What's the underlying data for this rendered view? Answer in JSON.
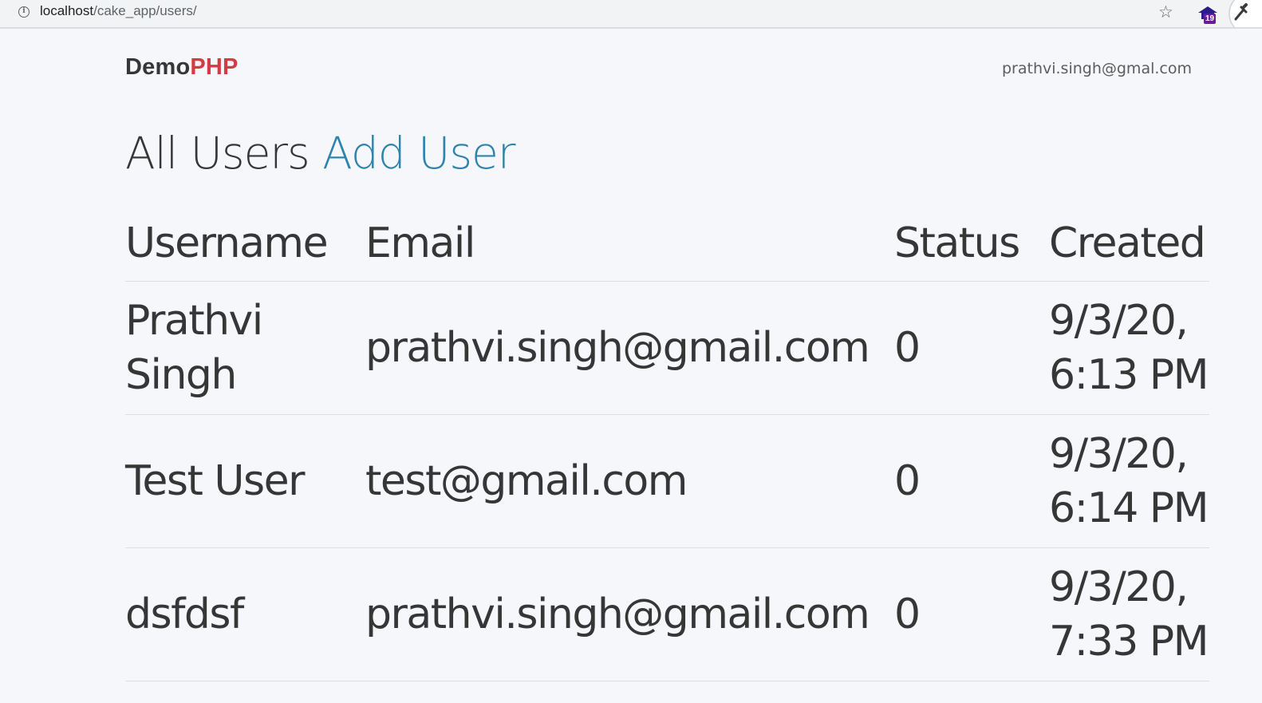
{
  "browser": {
    "url_host": "localhost",
    "url_path": "/cake_app/users/",
    "extension_badge": "19"
  },
  "header": {
    "brand_part1": "Demo",
    "brand_part2": "PHP",
    "user_email": "prathvi.singh@gmal.com"
  },
  "main": {
    "title": "All Users",
    "add_user_label": "Add User",
    "table": {
      "columns": [
        "Username",
        "Email",
        "Status",
        "Created"
      ],
      "rows": [
        {
          "username": "Prathvi Singh",
          "email": "prathvi.singh@gmail.com",
          "status": "0",
          "created": "9/3/20, 6:13 PM"
        },
        {
          "username": "Test User",
          "email": "test@gmail.com",
          "status": "0",
          "created": "9/3/20, 6:14 PM"
        },
        {
          "username": "dsfdsf",
          "email": "prathvi.singh@gmail.com",
          "status": "0",
          "created": "9/3/20, 7:33 PM"
        }
      ]
    }
  },
  "colors": {
    "brand_accent": "#d33c43",
    "link": "#2f84ae",
    "text": "#363637",
    "background": "#f6f7fa"
  },
  "icons": [
    "info-icon",
    "star-icon",
    "extension-icon",
    "eyedropper-icon"
  ]
}
